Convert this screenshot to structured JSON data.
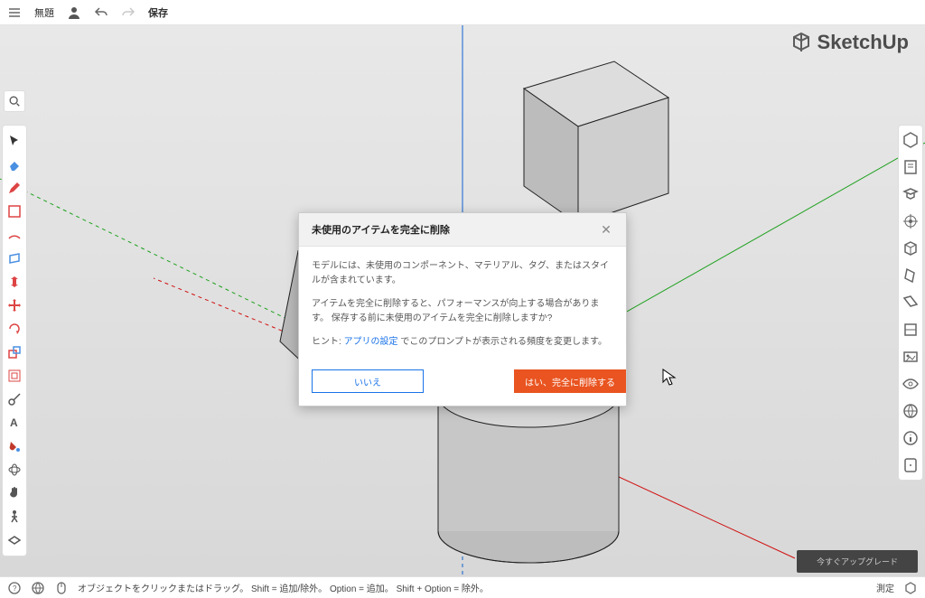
{
  "topbar": {
    "title": "無題",
    "save": "保存"
  },
  "brand": "SketchUp",
  "modal": {
    "title": "未使用のアイテムを完全に削除",
    "para1": "モデルには、未使用のコンポーネント、マテリアル、タグ、またはスタイルが含まれています。",
    "para2": "アイテムを完全に削除すると、パフォーマンスが向上する場合があります。 保存する前に未使用のアイテムを完全に削除しますか?",
    "hint_prefix": "ヒント: ",
    "hint_link": "アプリの設定",
    "hint_suffix": " でこのプロンプトが表示される頻度を変更します。",
    "btn_no": "いいえ",
    "btn_yes": "はい、完全に削除する"
  },
  "upgrade": "今すぐアップグレード",
  "status": {
    "text": "オブジェクトをクリックまたはドラッグ。 Shift = 追加/除外。 Option = 追加。 Shift + Option = 除外。",
    "measure_label": "測定"
  },
  "left_tools": [
    "select",
    "eraser",
    "pencil",
    "line",
    "arc",
    "rectangle",
    "pushpull",
    "move",
    "rotate",
    "scale",
    "offset",
    "tape",
    "protractor",
    "text",
    "paint",
    "orbit",
    "pan",
    "zoom"
  ],
  "right_panels": [
    "entity-info",
    "instructor",
    "components",
    "materials",
    "styles",
    "tags",
    "scenes",
    "shadows",
    "outliner",
    "display",
    "location",
    "info-panel",
    "help",
    "softedges"
  ]
}
